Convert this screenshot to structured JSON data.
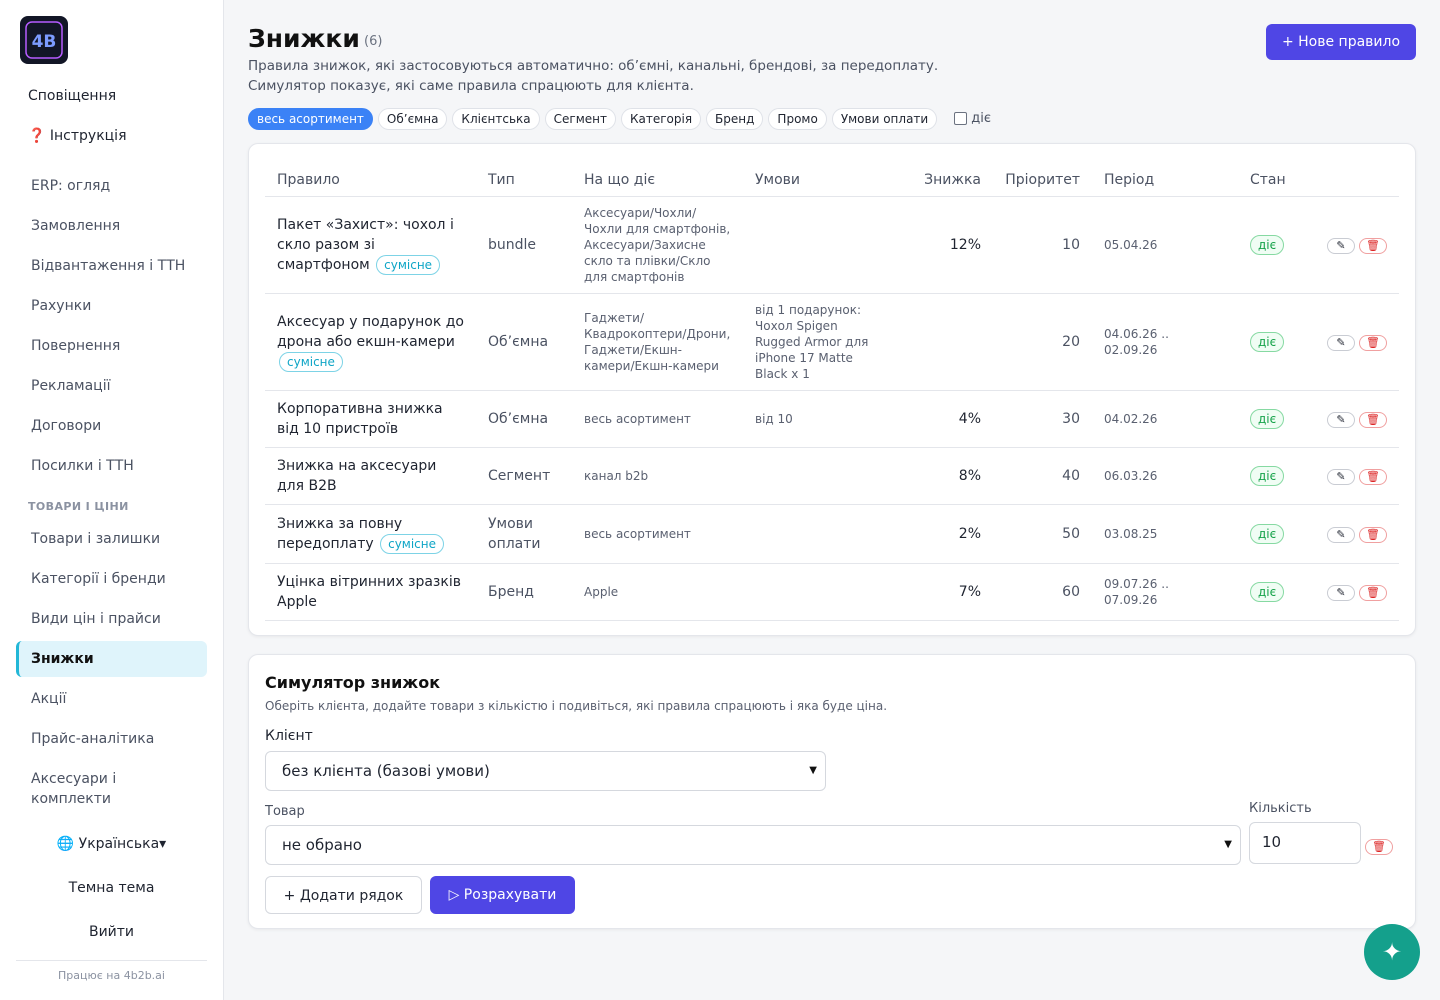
{
  "sidebar": {
    "notifications": "Сповіщення",
    "help": "❓ Інструкція",
    "nav": [
      "ERP: огляд",
      "Замовлення",
      "Відвантаження і ТТН",
      "Рахунки",
      "Повернення",
      "Рекламації",
      "Договори",
      "Посилки і ТТН"
    ],
    "section": "ТОВАРИ І ЦІНИ",
    "nav2": [
      "Товари і залишки",
      "Категорії і бренди",
      "Види цін і прайси",
      "Знижки",
      "Акції",
      "Прайс-аналітика",
      "Аксесуари і комплекти"
    ],
    "active": "Знижки",
    "language": "🌐 Українська▾",
    "theme": "Темна тема",
    "logout": "Вийти",
    "powered": "Працює на 4b2b.ai"
  },
  "header": {
    "title": "Знижки",
    "count": "(6)",
    "subtitle1": "Правила знижок, які застосовуються автоматично: об’ємні, канальні, брендові, за передоплату.",
    "subtitle2": "Симулятор показує, які саме правила спрацюють для клієнта.",
    "new_rule": "+ Нове правило"
  },
  "filters": {
    "chips": [
      "весь асортимент",
      "Об’ємна",
      "Клієнтська",
      "Сегмент",
      "Категорія",
      "Бренд",
      "Промо",
      "Умови оплати"
    ],
    "active_chip": "весь асортимент",
    "active_only_label": "діє"
  },
  "table": {
    "columns": [
      "Правило",
      "Тип",
      "На що діє",
      "Умови",
      "Знижка",
      "Пріоритет",
      "Період",
      "Стан"
    ],
    "rows": [
      {
        "name": "Пакет «Захист»: чохол і скло разом зі смартфоном",
        "badge": "сумісне",
        "type": "bundle",
        "scope": "Аксесуари/Чохли/Чохли для смартфонів, Аксесуари/Захисне скло та плівки/Скло для смартфонів",
        "cond": "",
        "disc": "12%",
        "prio": "10",
        "period": "05.04.26",
        "state": "діє"
      },
      {
        "name": "Аксесуар у подарунок до дрона або екшн-камери",
        "badge": "сумісне",
        "type": "Об’ємна",
        "scope": "Гаджети/Квадрокоптери/Дрони, Гаджети/Екшн-камери/Екшн-камери",
        "cond": "від 1 подарунок: Чохол Spigen Rugged Armor для iPhone 17 Matte Black x 1",
        "disc": "",
        "prio": "20",
        "period": "04.06.26 .. 02.09.26",
        "state": "діє"
      },
      {
        "name": "Корпоративна знижка від 10 пристроїв",
        "badge": "",
        "type": "Об’ємна",
        "scope": "весь асортимент",
        "cond": "від 10",
        "disc": "4%",
        "prio": "30",
        "period": "04.02.26",
        "state": "діє"
      },
      {
        "name": "Знижка на аксесуари для B2B",
        "badge": "",
        "type": "Сегмент",
        "scope": "канал b2b",
        "cond": "",
        "disc": "8%",
        "prio": "40",
        "period": "06.03.26",
        "state": "діє"
      },
      {
        "name": "Знижка за повну передоплату",
        "badge": "сумісне",
        "type": "Умови оплати",
        "scope": "весь асортимент",
        "cond": "",
        "disc": "2%",
        "prio": "50",
        "period": "03.08.25",
        "state": "діє"
      },
      {
        "name": "Уцінка вітринних зразків Apple",
        "badge": "",
        "type": "Бренд",
        "scope": "Apple",
        "cond": "",
        "disc": "7%",
        "prio": "60",
        "period": "09.07.26 .. 07.09.26",
        "state": "діє"
      }
    ]
  },
  "simulator": {
    "title": "Симулятор знижок",
    "subtitle": "Оберіть клієнта, додайте товари з кількістю і подивіться, які правила спрацюють і яка буде ціна.",
    "client_label": "Клієнт",
    "client_value": "без клієнта (базові умови)",
    "product_label": "Товар",
    "product_value": "не обрано",
    "qty_label": "Кількість",
    "qty_value": "10",
    "add_row": "+ Додати рядок",
    "calculate": "▷ Розрахувати"
  },
  "icons": {
    "edit": "pencil-icon",
    "delete": "trash-icon",
    "fab": "sparkles-icon"
  },
  "colors": {
    "accent": "#4f46e5",
    "active_nav": "#dff4fb",
    "fab": "#14a08c",
    "chip_active": "#3b82f6"
  }
}
